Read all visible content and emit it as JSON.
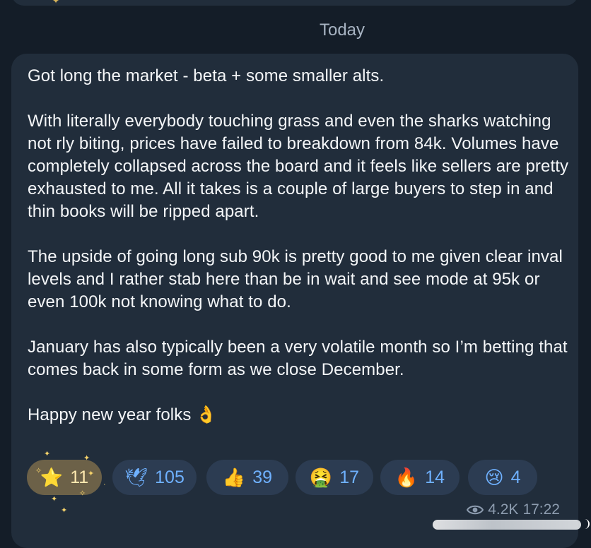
{
  "date_label": "Today",
  "message": {
    "paragraphs": [
      "Got long the market - beta + some smaller alts.",
      "With literally everybody touching grass and even the sharks watching not rly biting, prices have failed to breakdown from 84k. Volumes have completely collapsed across the board and it feels like sellers are pretty exhausted to me. All it takes is a couple of large buyers to step in and thin books will be ripped apart.",
      "The upside of going long sub 90k is pretty good to me given clear inval levels and I rather stab here than be in wait and see mode at 95k or even 100k not knowing what to do.",
      "January has also typically been a very volatile month so I’m betting that comes back in some form as we close December.",
      "Happy new year folks"
    ],
    "closing_emoji": "👌"
  },
  "reactions": [
    {
      "emoji": "⭐",
      "count": "11",
      "active": true
    },
    {
      "emoji": "🕊",
      "count": "105",
      "active": false
    },
    {
      "emoji": "👍",
      "count": "39",
      "active": false
    },
    {
      "emoji": "🤮",
      "count": "17",
      "active": false
    },
    {
      "emoji": "🔥",
      "count": "14",
      "active": false
    },
    {
      "emoji": "😢",
      "count": "4",
      "active": false
    }
  ],
  "meta": {
    "views": "4.2K",
    "time": "17:22",
    "icon": "eye-icon"
  },
  "colors": {
    "background": "#141d28",
    "bubble": "#212d3b",
    "reaction_pill": "#2c3c52",
    "reaction_active": "#6c6148",
    "accent_text": "#6fb1ff"
  }
}
